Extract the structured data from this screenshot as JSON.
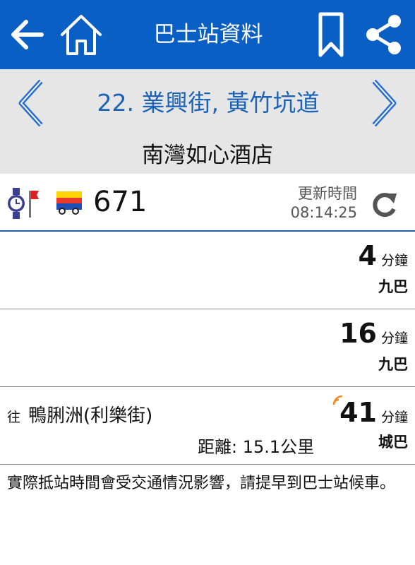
{
  "header": {
    "title": "巴士站資料",
    "icons": {
      "back": "arrow-left-icon",
      "home": "home-icon",
      "bookmark": "bookmark-icon",
      "share": "share-icon"
    },
    "background": "#0a5fc4"
  },
  "stop": {
    "name": "22. 業興街, 黃竹坑道",
    "landmark": "南灣如心酒店",
    "icons": {
      "prev": "chevron-left-icon",
      "next": "chevron-right-icon"
    }
  },
  "route": {
    "number": "671",
    "update_label": "更新時間",
    "update_time": "08:14:25",
    "icons": {
      "alarm": "alarm-clock-flag-icon",
      "bus": "bus-icon",
      "refresh": "refresh-icon"
    }
  },
  "etas": [
    {
      "minutes": "4",
      "unit": "分鐘",
      "company": "九巴"
    },
    {
      "minutes": "16",
      "unit": "分鐘",
      "company": "九巴"
    },
    {
      "dest_prefix": "往",
      "destination": "鴨脷洲(利樂街)",
      "distance": "距離: 15.1公里",
      "minutes": "41",
      "unit": "分鐘",
      "company": "城巴",
      "gps_icon": "gps-signal-icon"
    }
  ],
  "notice": "實際抵站時間會受交通情況影響，請提早到巴士站候車。"
}
